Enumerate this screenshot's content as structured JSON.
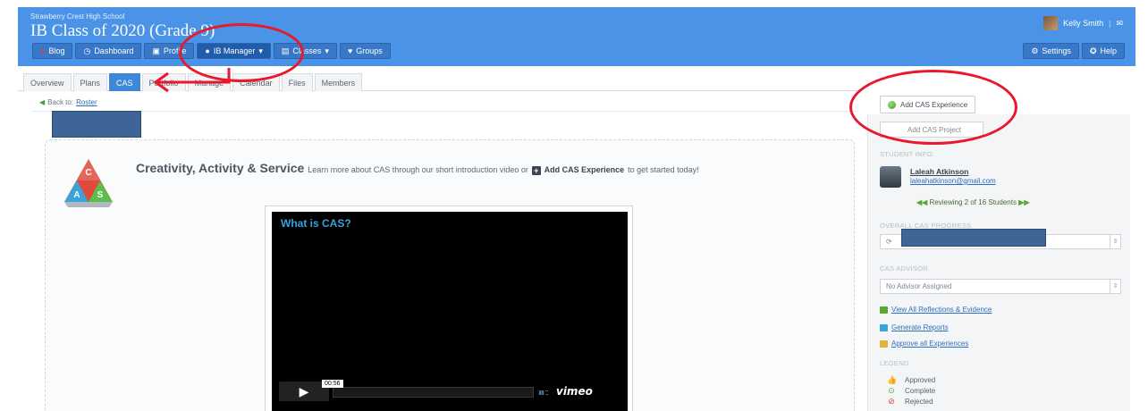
{
  "header": {
    "school": "Strawberry Crest High School",
    "class_title": "IB Class of 2020 (Grade 9)",
    "user_name": "Kelly Smith",
    "nav": [
      {
        "label": "Blog",
        "icon": "blog-icon"
      },
      {
        "label": "Dashboard",
        "icon": "dashboard-icon"
      },
      {
        "label": "Profile",
        "icon": "profile-icon"
      },
      {
        "label": "IB Manager",
        "icon": "ib-manager-icon"
      },
      {
        "label": "Classes",
        "icon": "classes-icon"
      },
      {
        "label": "Groups",
        "icon": "groups-icon"
      }
    ],
    "settings_label": "Settings",
    "help_label": "Help"
  },
  "tabs": [
    "Overview",
    "Plans",
    "CAS",
    "Portfolio",
    "Manage",
    "Calendar",
    "Files",
    "Members"
  ],
  "active_tab": "CAS",
  "back": {
    "prefix": "Back to:",
    "link": "Roster"
  },
  "main": {
    "heading": "Creativity, Activity & Service",
    "intro": "Learn more about CAS through our short introduction video or",
    "add_link": "Add CAS Experience",
    "suffix": "to get started today!",
    "video": {
      "title": "What is CAS?",
      "time": "00:56",
      "brand": "vimeo"
    }
  },
  "sidebar": {
    "add_button": "Add CAS Experience",
    "second_button": "Add CAS Project",
    "student_info_label": "STUDENT INFO",
    "student_name": "Laleah Atkinson",
    "student_email": "laleahatkinson@gmail.com",
    "reviewing": "Reviewing 2 of 16 Students",
    "progress_label": "OVERALL CAS PROGRESS",
    "advisor_label": "CAS ADVISOR",
    "advisor_value": "No Advisor Assigned",
    "links": [
      "View All Reflections & Evidence",
      "Generate Reports",
      "Approve all Experiences"
    ],
    "legend_label": "LEGEND",
    "legend": [
      "Approved",
      "Complete",
      "Rejected"
    ]
  },
  "colors": {
    "header_blue": "#4a93e6",
    "accent": "#3d86d8",
    "annotation_red": "#e8192c",
    "redaction": "#3f6597"
  }
}
